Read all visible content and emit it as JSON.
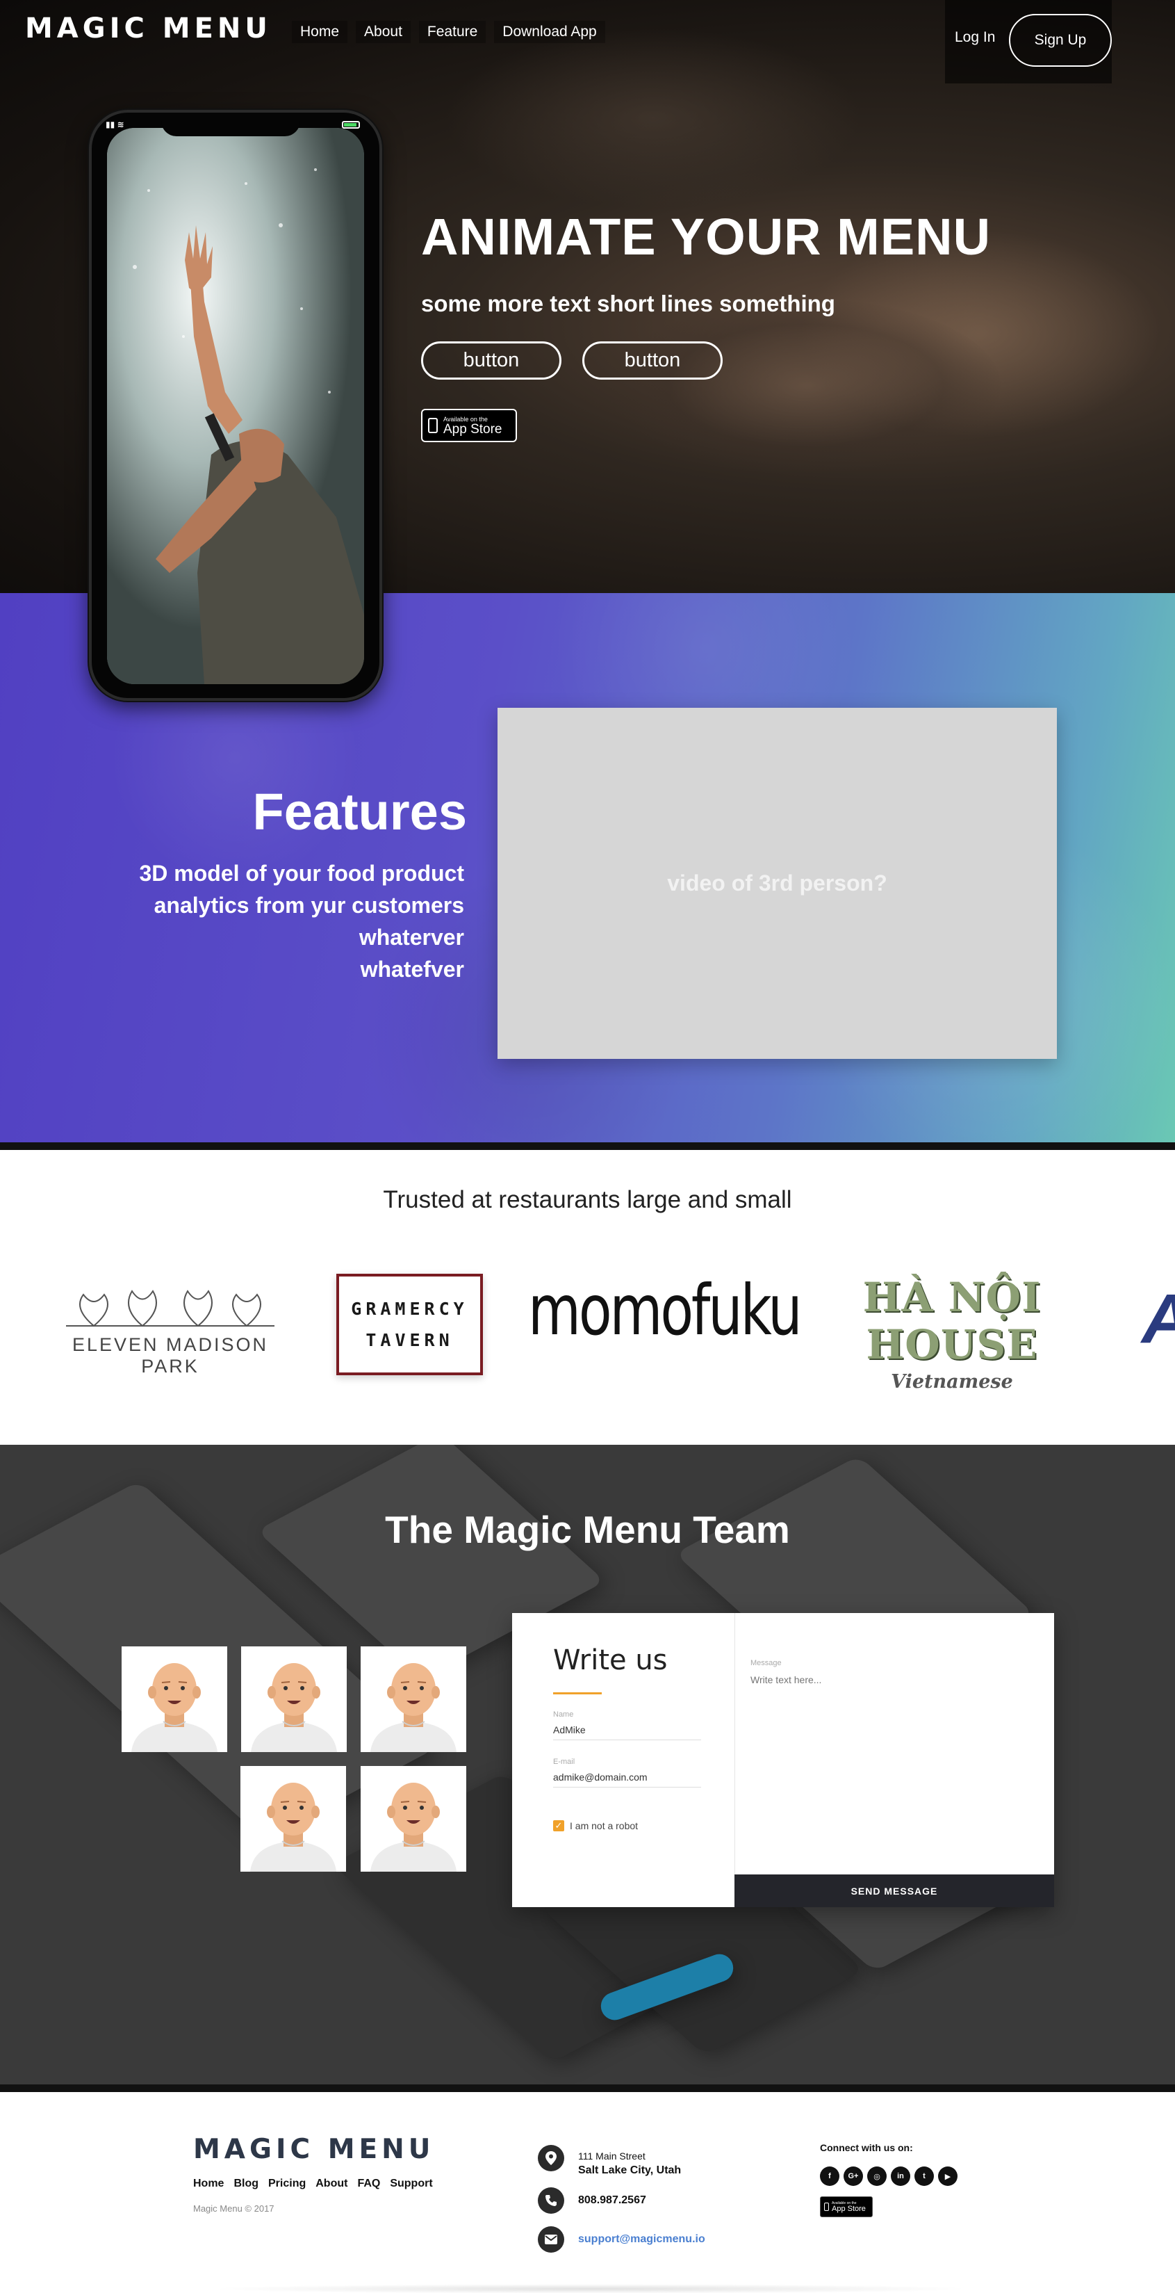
{
  "brand": "MAGIC MENU",
  "nav": {
    "items": [
      "Home",
      "About",
      "Feature",
      "Download App"
    ],
    "login": "Log In",
    "signup": "Sign Up"
  },
  "hero": {
    "headline": "ANIMATE YOUR MENU",
    "subline": "some more text short lines something",
    "button1": "button",
    "button2": "button",
    "appstore_small": "Available on the",
    "appstore_big": "App Store"
  },
  "features": {
    "title": "Features",
    "items": [
      "3D model of your food product",
      "analytics from yur customers",
      "whaterver",
      "whatefver"
    ],
    "video_placeholder": "video of 3rd person?"
  },
  "trusted": {
    "title": "Trusted at restaurants large and small",
    "logos": {
      "emp": "ELEVEN MADISON PARK",
      "gramercy_line1": "GRAMERCY",
      "gramercy_line2": "TAVERN",
      "momofuku": "momofuku",
      "hanoi_main": "HÀ NỘI HOUSE",
      "hanoi_sub": "Vietnamese"
    }
  },
  "team": {
    "title": "The Magic Menu Team",
    "avatar_count": 5
  },
  "contact": {
    "title": "Write us",
    "name_label": "Name",
    "name_value": "AdMike",
    "email_label": "E-mail",
    "email_value": "admike@domain.com",
    "robot_label": "I am not a robot",
    "robot_checked": true,
    "message_label": "Message",
    "message_placeholder": "Write text here...",
    "send": "SEND MESSAGE"
  },
  "footer": {
    "brand": "MAGIC MENU",
    "links": [
      "Home",
      "Blog",
      "Pricing",
      "About",
      "FAQ",
      "Support"
    ],
    "copyright": "Magic Menu © 2017",
    "address_line1": "111 Main Street",
    "address_line2": "Salt Lake City, Utah",
    "phone": "808.987.2567",
    "email": "support@magicmenu.io",
    "connect": "Connect with us on:",
    "socials": [
      "facebook-icon",
      "google-plus-icon",
      "instagram-icon",
      "linkedin-icon",
      "twitter-icon",
      "youtube-icon"
    ],
    "appstore_small": "Available on the",
    "appstore_big": "App Store"
  },
  "colors": {
    "features_start": "#5140c2",
    "features_end": "#6ac8b4",
    "accent_orange": "#f0a12a",
    "send_button": "#24252b",
    "email_link": "#4a7fd0"
  }
}
